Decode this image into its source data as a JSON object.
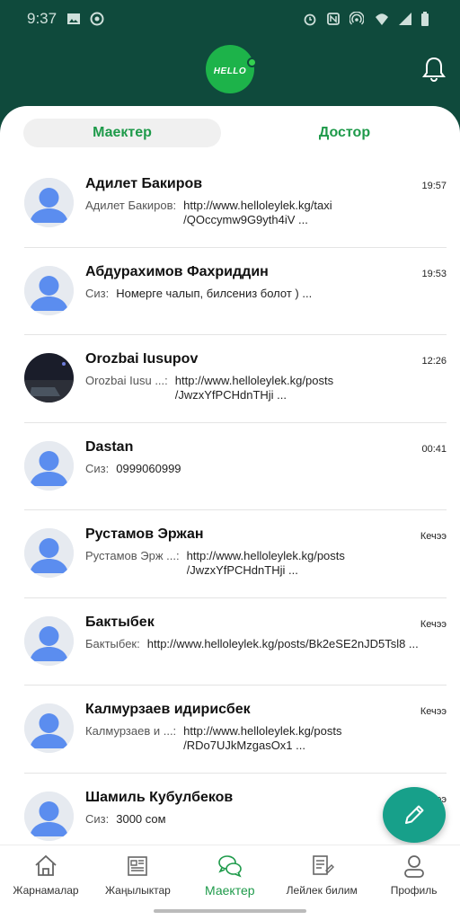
{
  "status_bar": {
    "time": "9:37"
  },
  "header": {
    "logo_text": "HELLO"
  },
  "tabs": {
    "messages": "Маектер",
    "friends": "Достор"
  },
  "conversations": [
    {
      "name": "Адилет Бакиров",
      "time": "19:57",
      "sender": "Адилет Бакиров:",
      "message": "http://www.helloleylek.kg/taxi\n/QOccymw9G9yth4iV ..."
    },
    {
      "name": "Абдурахимов Фахриддин",
      "time": "19:53",
      "sender": "Сиз:",
      "message": "Номерге чалып, билсениз болот ) ..."
    },
    {
      "name": "Orozbai Iusupov",
      "time": "12:26",
      "sender": "Orozbai Iusu ...:",
      "message": "http://www.helloleylek.kg/posts\n/JwzxYfPCHdnTHji ..."
    },
    {
      "name": "Dastan",
      "time": "00:41",
      "sender": "Сиз:",
      "message": "0999060999"
    },
    {
      "name": "Рустамов Эржан",
      "time": "Кечээ",
      "sender": "Рустамов Эрж ...:",
      "message": "http://www.helloleylek.kg/posts\n/JwzxYfPCHdnTHji ..."
    },
    {
      "name": "Бактыбек",
      "time": "Кечээ",
      "sender": "Бактыбек:",
      "message": "http://www.helloleylek.kg/posts/Bk2eSE2nJD5Tsl8 ..."
    },
    {
      "name": "Калмурзаев идирисбек",
      "time": "Кечээ",
      "sender": "Калмурзаев и ...:",
      "message": "http://www.helloleylek.kg/posts\n/RDo7UJkMzgasOx1 ..."
    },
    {
      "name": "Шамиль Кубулбеков",
      "time": "Кечээ",
      "sender": "Сиз:",
      "message": "3000 сом"
    }
  ],
  "bottom_nav": [
    {
      "label": "Жарнамалар",
      "icon": "home-icon"
    },
    {
      "label": "Жаңылыктар",
      "icon": "newspaper-icon"
    },
    {
      "label": "Маектер",
      "icon": "chat-icon",
      "active": true
    },
    {
      "label": "Лейлек билим",
      "icon": "document-icon"
    },
    {
      "label": "Профиль",
      "icon": "profile-icon"
    }
  ],
  "colors": {
    "header_bg": "#0f4a3c",
    "accent": "#1e9a4a",
    "fab": "#17a08a",
    "avatar": "#5b8def"
  }
}
